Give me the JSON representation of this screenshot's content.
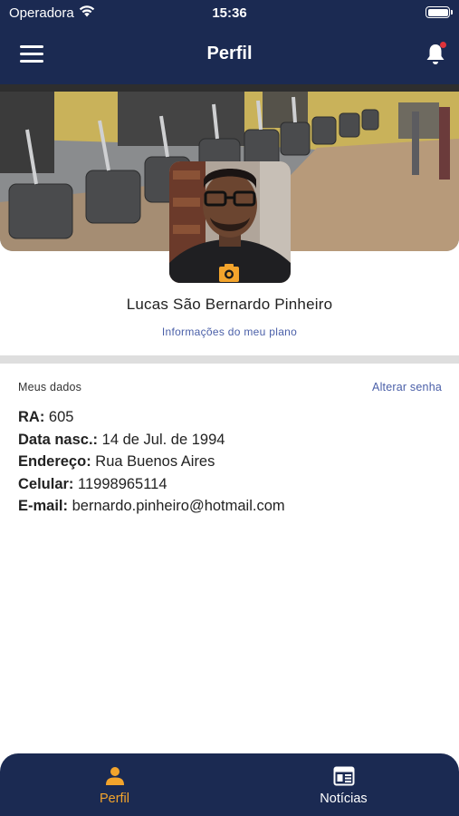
{
  "status_bar": {
    "carrier": "Operadora",
    "time": "15:36"
  },
  "header": {
    "title": "Perfil",
    "notification_dot_color": "#e0333a"
  },
  "profile": {
    "name": "Lucas São Bernardo Pinheiro",
    "plan_link": "Informações do meu plano"
  },
  "my_data": {
    "section_title": "Meus dados",
    "change_password": "Alterar senha",
    "fields": [
      {
        "label": "RA:",
        "value": "605"
      },
      {
        "label": "Data nasc.:",
        "value": "14 de Jul. de 1994"
      },
      {
        "label": "Endereço:",
        "value": "Rua Buenos Aires"
      },
      {
        "label": "Celular:",
        "value": "11998965114"
      },
      {
        "label": "E-mail:",
        "value": "bernardo.pinheiro@hotmail.com"
      }
    ]
  },
  "tab_bar": {
    "tabs": [
      {
        "label": "Perfil",
        "icon": "person-icon",
        "active": true
      },
      {
        "label": "Notícias",
        "icon": "news-icon",
        "active": false
      }
    ],
    "active_color": "#f3a42c"
  },
  "colors": {
    "navy": "#1b2a52",
    "accent": "#f3a42c",
    "link": "#4a5fa8"
  }
}
